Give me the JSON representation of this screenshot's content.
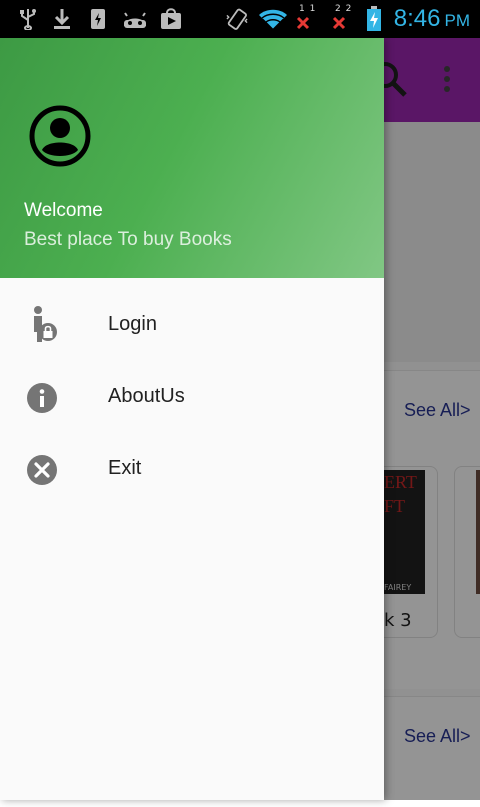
{
  "status_bar": {
    "time": "8:46",
    "ampm": "PM",
    "sim1_label": "1 1",
    "sim2_label": "2 2",
    "icons": [
      "usb-icon",
      "download-icon",
      "sd-card-icon",
      "android-debug-icon",
      "store-icon",
      "vibrate-icon",
      "wifi-icon",
      "signal-1-icon",
      "signal-2-icon",
      "battery-charging-icon"
    ]
  },
  "app": {
    "toolbar_color": "#9c27b0",
    "sections": [
      {
        "see_all_label": "See All>"
      },
      {
        "see_all_label": "See All>"
      }
    ],
    "visible_book": {
      "cover_title": "ERT",
      "cover_subtitle": "FT",
      "cover_author": "FAIREY",
      "caption": "k 3"
    }
  },
  "drawer": {
    "header_gradient": [
      "#3d9a44",
      "#81c784"
    ],
    "title": "Welcome",
    "subtitle": "Best place To buy Books",
    "items": [
      {
        "label": "Login",
        "icon": "login-lock-icon"
      },
      {
        "label": "AboutUs",
        "icon": "info-icon"
      },
      {
        "label": "Exit",
        "icon": "close-circle-icon"
      }
    ]
  }
}
